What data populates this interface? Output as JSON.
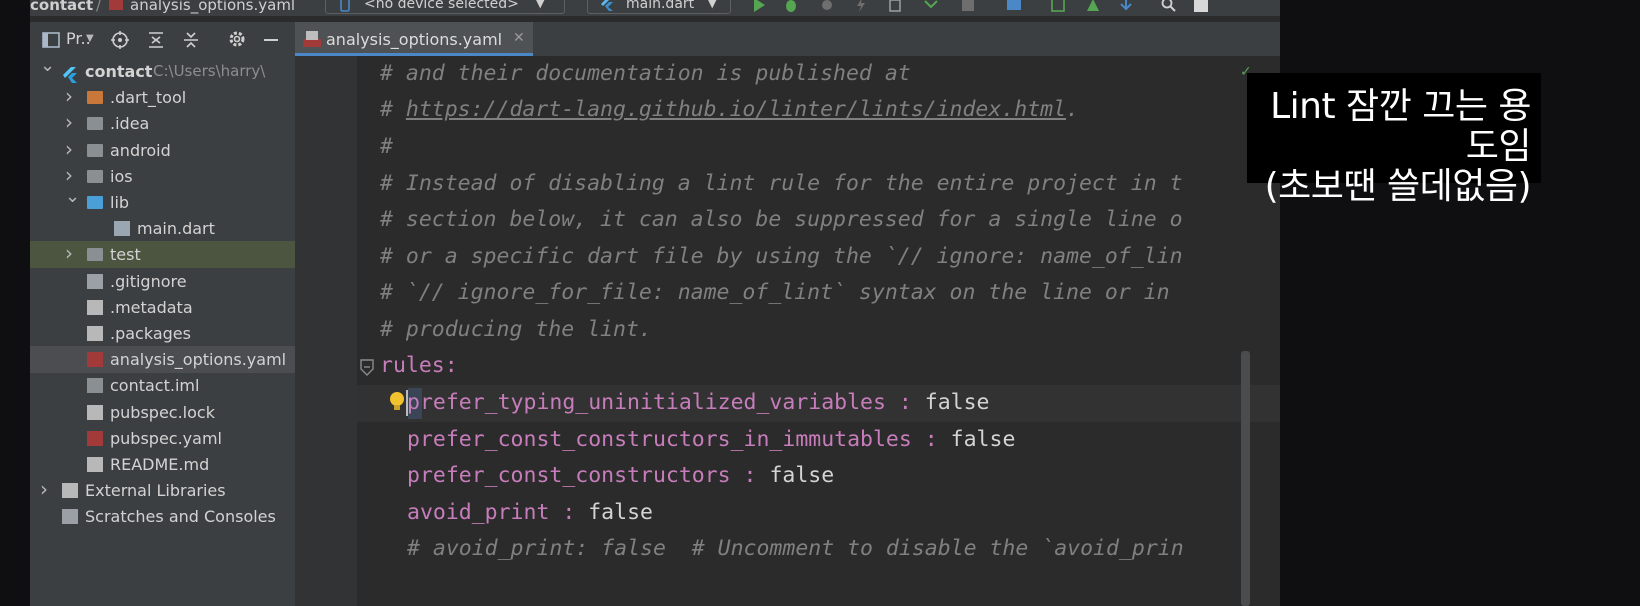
{
  "navbar": {
    "breadcrumb_project": "contact",
    "breadcrumb_sep": "/",
    "breadcrumb_file": "analysis_options.yaml",
    "device_selector": "<no device selected>",
    "run_config": "main.dart"
  },
  "project_panel": {
    "title": "Pr..",
    "tree": [
      {
        "label": "contact",
        "path": "C:\\Users\\harry\\",
        "icon": "flutter-project-icon",
        "arrow": "expanded"
      },
      {
        "label": ".dart_tool",
        "icon": "folder-orange-icon",
        "arrow": "collapsed"
      },
      {
        "label": ".idea",
        "icon": "folder-gear-icon",
        "arrow": "collapsed"
      },
      {
        "label": "android",
        "icon": "folder-icon",
        "arrow": "collapsed"
      },
      {
        "label": "ios",
        "icon": "folder-icon",
        "arrow": "collapsed"
      },
      {
        "label": "lib",
        "icon": "folder-blue-icon",
        "arrow": "expanded"
      },
      {
        "label": "main.dart",
        "icon": "dart-file-icon",
        "arrow": "none"
      },
      {
        "label": "test",
        "icon": "folder-test-icon",
        "arrow": "collapsed"
      },
      {
        "label": ".gitignore",
        "icon": "gitignore-file-icon",
        "arrow": "none"
      },
      {
        "label": ".metadata",
        "icon": "file-icon",
        "arrow": "none"
      },
      {
        "label": ".packages",
        "icon": "file-icon",
        "arrow": "none"
      },
      {
        "label": "analysis_options.yaml",
        "icon": "yaml-file-icon",
        "arrow": "none"
      },
      {
        "label": "contact.iml",
        "icon": "iml-file-icon",
        "arrow": "none"
      },
      {
        "label": "pubspec.lock",
        "icon": "file-icon",
        "arrow": "none"
      },
      {
        "label": "pubspec.yaml",
        "icon": "yaml-file-icon",
        "arrow": "none"
      },
      {
        "label": "README.md",
        "icon": "file-icon",
        "arrow": "none"
      },
      {
        "label": "External Libraries",
        "icon": "libraries-icon",
        "arrow": "collapsed"
      },
      {
        "label": "Scratches and Consoles",
        "icon": "scratches-icon",
        "arrow": "none"
      }
    ]
  },
  "editor": {
    "tab_label": "analysis_options.yaml",
    "lines": {
      "l1": "# and their documentation is published at",
      "l2_prefix": "# ",
      "l2_link": "https://dart-lang.github.io/linter/lints/index.html",
      "l2_suffix": ".",
      "l3": "#",
      "l4": "# Instead of disabling a lint rule for the entire project in t",
      "l5": "# section below, it can also be suppressed for a single line o",
      "l6": "# or a specific dart file by using the `// ignore: name_of_lin",
      "l7": "# `// ignore_for_file: name_of_lint` syntax on the line or in",
      "l8": "# producing the lint.",
      "l9_key": "rules",
      "l9_colon": ":",
      "rules": [
        {
          "key": "prefer_typing_uninitialized_variables",
          "sep": " : ",
          "value": "false"
        },
        {
          "key": "prefer_const_constructors_in_immutables",
          "sep": " : ",
          "value": "false"
        },
        {
          "key": "prefer_const_constructors",
          "sep": " : ",
          "value": "false"
        },
        {
          "key": "avoid_print",
          "sep": " : ",
          "value": "false"
        }
      ],
      "l14": "# avoid_print: false  # Uncomment to disable the `avoid_prin"
    }
  },
  "caption": {
    "line1": "Lint 잠깐 끄는 용도임",
    "line2": "(초보땐 쓸데없음)"
  },
  "colors": {
    "accent": "#4a88c7",
    "keyword": "#c77dbb",
    "comment": "#808080"
  }
}
